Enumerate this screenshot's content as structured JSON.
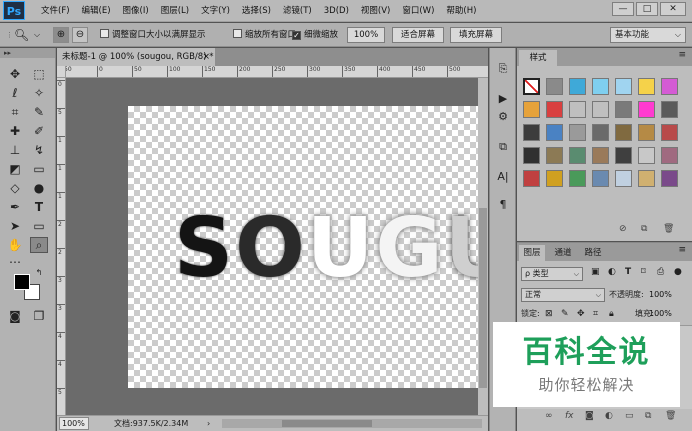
{
  "app": {
    "logo": "Ps",
    "menu": [
      "文件(F)",
      "编辑(E)",
      "图像(I)",
      "图层(L)",
      "文字(Y)",
      "选择(S)",
      "滤镜(T)",
      "3D(D)",
      "视图(V)",
      "窗口(W)",
      "帮助(H)"
    ],
    "window_controls": {
      "minimize": "—",
      "maximize": "□",
      "close": "✕"
    }
  },
  "options": {
    "resize_windows": "调整窗口大小以满屏显示",
    "zoom_all_windows": "缩放所有窗口",
    "scrubby_zoom": "细微缩放",
    "zoom_value": "100%",
    "fit_screen": "适合屏幕",
    "fill_screen": "填充屏幕",
    "workspace": "基本功能",
    "resize_checked": false,
    "zoom_all_checked": false,
    "scrubby_checked": true
  },
  "document": {
    "tab_title": "未标题-1 @ 100% (sougou, RGB/8) *",
    "tab_close": "×",
    "canvas_text_parts": [
      "S",
      "O",
      "U",
      "G",
      "U"
    ],
    "status_zoom": "100%",
    "status_info": "文档:937.5K/2.34M",
    "ruler_top": [
      "50",
      "0",
      "50",
      "100",
      "150",
      "200",
      "250",
      "300",
      "350",
      "400",
      "450",
      "500"
    ],
    "ruler_left": [
      "0",
      "5",
      "1",
      "1",
      "1",
      "2",
      "2",
      "3",
      "3",
      "4",
      "4",
      "5"
    ]
  },
  "panels": {
    "styles": {
      "tab": "样式",
      "menu": "≡",
      "swatches": [
        "#ffffff",
        "#8a8a8a",
        "#3fa9d8",
        "#7fcfef",
        "#a0d4f0",
        "#f5d24a",
        "#d45bd4",
        "#e6a23a",
        "#d94040",
        "#bfbfbf",
        "#bfbfbf",
        "#7a7a7a",
        "#ff3ad0",
        "#5a5a5a",
        "#3c3c3c",
        "#4a82c3",
        "#9a9a9a",
        "#6a6a6a",
        "#806a40",
        "#b58a45",
        "#b84a4a",
        "#303030",
        "#8c7a55",
        "#5a8c70",
        "#9a7a5a",
        "#3f3f3f",
        "#c8c8c8",
        "#a06a80",
        "#c04040",
        "#d0a020",
        "#4a9a5a",
        "#6a8ab0",
        "#c0d0e0",
        "#d0b070",
        "#7a4a8a"
      ]
    },
    "layers": {
      "tabs": [
        "图层",
        "通道",
        "路径"
      ],
      "menu": "≡",
      "kind_filter": "ρ 类型",
      "blend_mode": "正常",
      "opacity_label": "不透明度:",
      "opacity_value": "100%",
      "lock_label": "锁定:",
      "fill_label": "填充:",
      "fill_value": "100%"
    }
  },
  "watermark": {
    "title": "百科全说",
    "subtitle": "助你轻松解决"
  }
}
